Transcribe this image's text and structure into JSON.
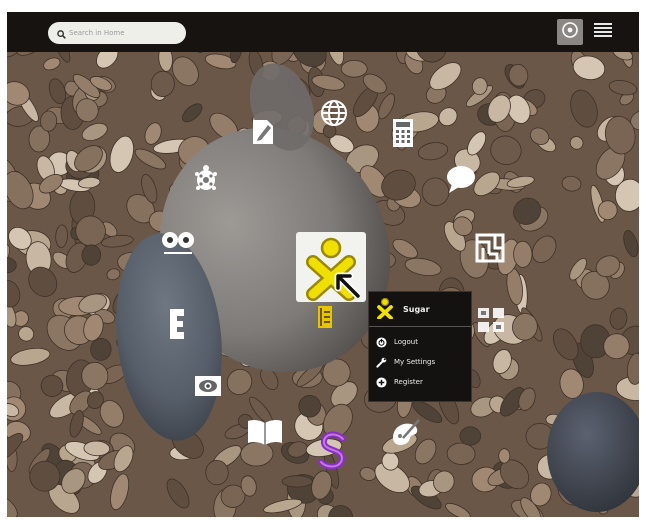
{
  "search": {
    "placeholder": "Search in Home"
  },
  "views": {
    "favorites_icon": "ring-icon",
    "list_icon": "list-icon"
  },
  "user": {
    "name": "Sugar",
    "fill_color": "#f0e000",
    "stroke_color": "#9a8800"
  },
  "palette": {
    "items": [
      {
        "label": "Logout",
        "icon": "power-icon"
      },
      {
        "label": "My Settings",
        "icon": "wrench-icon"
      },
      {
        "label": "Register",
        "icon": "plus-circle-icon"
      }
    ]
  },
  "activities": [
    "write-icon",
    "browse-icon",
    "calculate-icon",
    "turtle-icon",
    "chat-icon",
    "memorize-icon",
    "speak-icon",
    "maze-icon",
    "journal-icon",
    "etoys-icon",
    "record-icon",
    "read-icon",
    "scratch-icon",
    "paint-icon",
    "terminal-icon"
  ]
}
